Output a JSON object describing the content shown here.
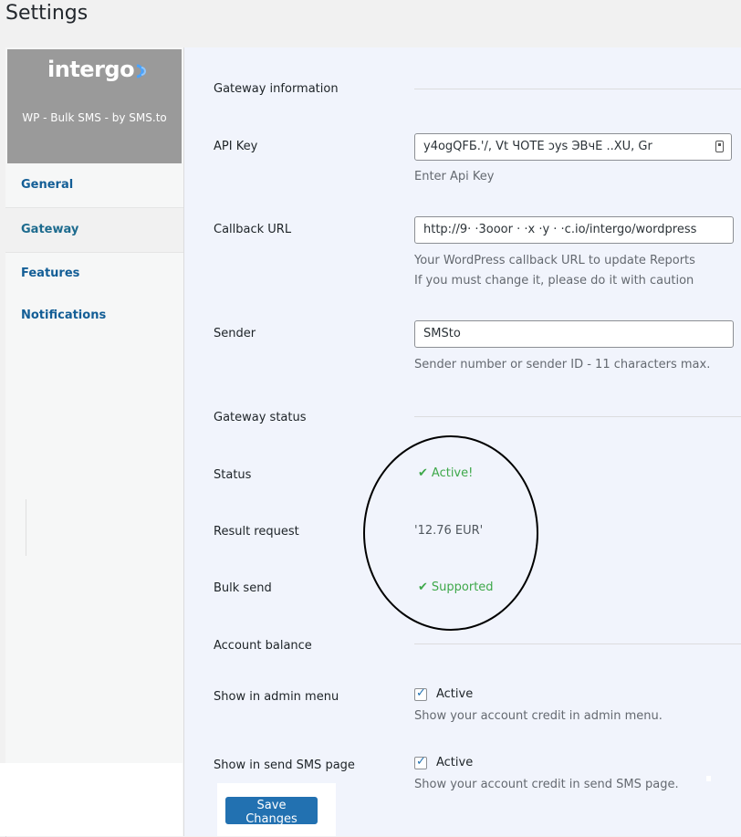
{
  "page": {
    "title": "Settings"
  },
  "brand": {
    "logo_text": "intergo",
    "tagline": "WP - Bulk SMS - by SMS.to"
  },
  "nav": {
    "items": [
      {
        "label": "General"
      },
      {
        "label": "Gateway"
      },
      {
        "label": "Features"
      },
      {
        "label": "Notifications"
      }
    ],
    "active": "Gateway"
  },
  "sections": {
    "gateway_information": "Gateway information",
    "gateway_status": "Gateway status",
    "account_balance": "Account balance"
  },
  "fields": {
    "api_key": {
      "label": "API Key",
      "value": "y4ogQFБ.'/, Vt ЧОТЕ ɔys ЭВчЕ ..XU, Gr",
      "help": "Enter Api Key"
    },
    "callback_url": {
      "label": "Callback URL",
      "value": "http://9·   ·3ooor ·   ·x ·y ·   ·c.io/intergo/wordpress",
      "help_1": "Your WordPress callback URL to update Reports",
      "help_2": "If you must change it, please do it with caution"
    },
    "sender": {
      "label": "Sender",
      "value": "SMSto",
      "help": "Sender number or sender ID - 11 characters max."
    }
  },
  "status": {
    "status_label": "Status",
    "status_value": "Active!",
    "result_label": "Result request",
    "result_value": "'12.76 EUR'",
    "bulk_label": "Bulk send",
    "bulk_value": "Supported"
  },
  "balance": {
    "admin_menu": {
      "label": "Show in admin menu",
      "checkbox": "Active",
      "help": "Show your account credit in admin menu."
    },
    "send_sms": {
      "label": "Show in send SMS page",
      "checkbox": "Active",
      "help": "Show your account credit in send SMS page."
    }
  },
  "save_button": "Save Changes",
  "colors": {
    "accent": "#2271b1",
    "success": "#3ea84a",
    "link": "#135e96"
  }
}
